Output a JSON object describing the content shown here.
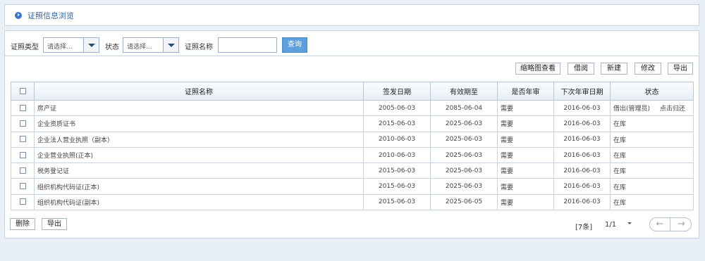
{
  "header": {
    "title": "证照信息浏览",
    "icon": "circle-arrow-icon"
  },
  "filters": {
    "type_label": "证照类型",
    "type_value": "请选择...",
    "status_label": "状态",
    "status_value": "请选择...",
    "name_label": "证照名称",
    "name_value": "",
    "query_label": "查询"
  },
  "toolbar": {
    "thumbnail_label": "缩略图查看",
    "borrow_label": "借阅",
    "new_label": "新建",
    "edit_label": "修改",
    "export_label": "导出"
  },
  "table": {
    "headers": [
      "证照名称",
      "签发日期",
      "有效期至",
      "是否年审",
      "下次年审日期",
      "状态"
    ],
    "rows": [
      {
        "name": "房产证",
        "issue": "2005-06-03",
        "valid": "2085-06-04",
        "review": "需要",
        "next": "2016-06-03",
        "status": "借出(管理员)",
        "action": "点击归还"
      },
      {
        "name": "企业资质证书",
        "issue": "2015-06-03",
        "valid": "2025-06-03",
        "review": "需要",
        "next": "2016-06-03",
        "status": "在库",
        "action": ""
      },
      {
        "name": "企业法人营业执照（副本）",
        "issue": "2010-06-03",
        "valid": "2025-06-03",
        "review": "需要",
        "next": "2016-06-03",
        "status": "在库",
        "action": ""
      },
      {
        "name": "企业营业执照(正本)",
        "issue": "2010-06-03",
        "valid": "2025-06-03",
        "review": "需要",
        "next": "2016-06-03",
        "status": "在库",
        "action": ""
      },
      {
        "name": "税务登记证",
        "issue": "2015-06-03",
        "valid": "2025-06-03",
        "review": "需要",
        "next": "2016-06-03",
        "status": "在库",
        "action": ""
      },
      {
        "name": "组织机构代码证(正本)",
        "issue": "2015-06-03",
        "valid": "2025-06-03",
        "review": "需要",
        "next": "2016-06-03",
        "status": "在库",
        "action": ""
      },
      {
        "name": "组织机构代码证(副本)",
        "issue": "2015-06-03",
        "valid": "2025-06-05",
        "review": "需要",
        "next": "2016-06-03",
        "status": "在库",
        "action": ""
      }
    ]
  },
  "footer": {
    "delete_label": "删除",
    "export_label": "导出",
    "count": "[7条]",
    "page": "1/1",
    "prev_icon": "arrow-left-icon",
    "next_icon": "arrow-right-icon"
  },
  "colors": {
    "accent": "#5d9fdc",
    "title": "#3567a8",
    "border": "#c5d3e3",
    "background": "#e9eff7"
  }
}
